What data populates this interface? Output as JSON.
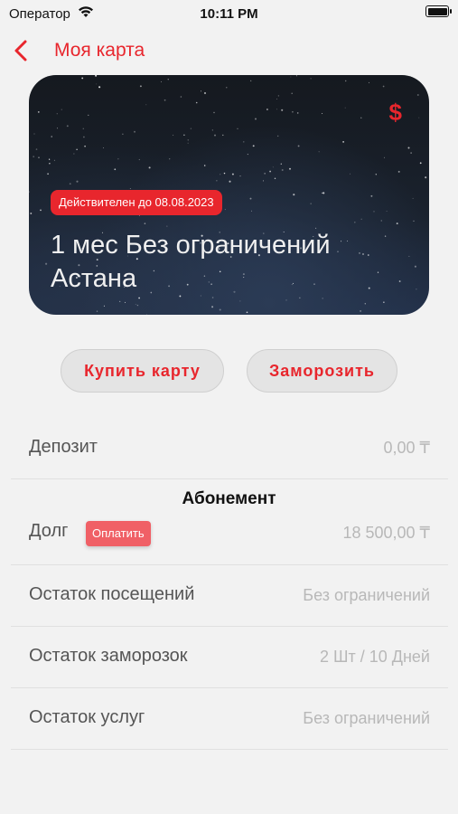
{
  "status_bar": {
    "carrier": "Оператор",
    "time": "10:11 PM"
  },
  "nav": {
    "title": "Моя карта"
  },
  "card": {
    "currency_symbol": "$",
    "valid_until": "Действителен до 08.08.2023",
    "title_line1": "1 мес Без ограничений",
    "title_line2": "Астана"
  },
  "actions": {
    "buy_label": "Купить карту",
    "freeze_label": "Заморозить"
  },
  "deposit": {
    "label": "Депозит",
    "value": "0,00 ₸"
  },
  "subscription": {
    "heading": "Абонемент",
    "debt_label": "Долг",
    "pay_label": "Оплатить",
    "debt_value": "18 500,00 ₸",
    "visits_label": "Остаток посещений",
    "visits_value": "Без ограничений",
    "freezes_label": "Остаток заморозок",
    "freezes_value": "2 Шт / 10 Дней",
    "services_label": "Остаток услуг",
    "services_value": "Без ограничений"
  },
  "colors": {
    "accent": "#e8262d",
    "background": "#f2f2f2"
  }
}
